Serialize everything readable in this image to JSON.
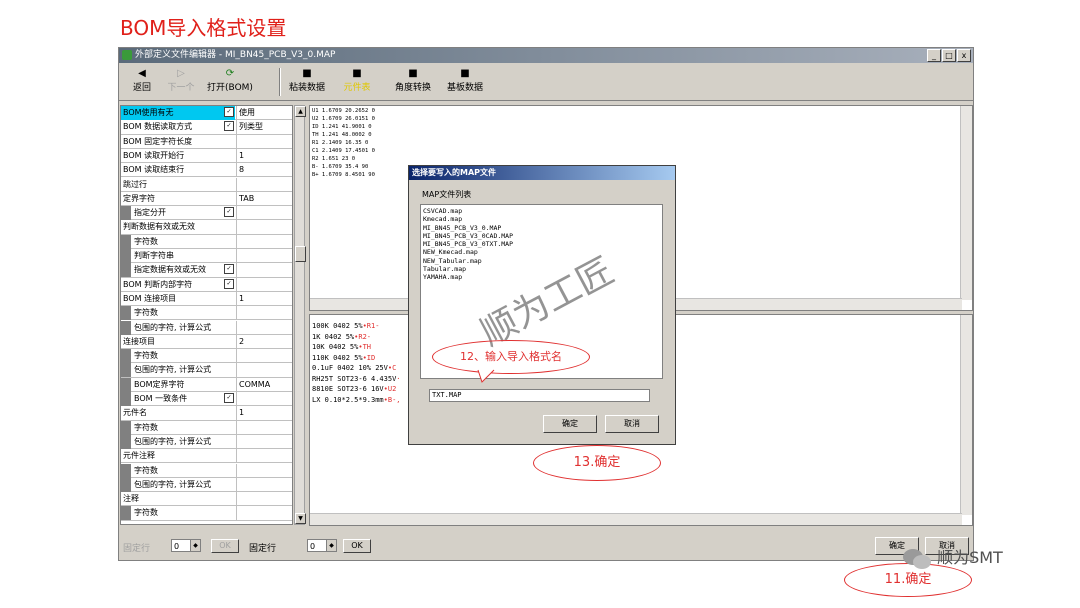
{
  "slide_title": "BOM导入格式设置",
  "window": {
    "title": "外部定义文件编辑器 - MI_BN45_PCB_V3_0.MAP",
    "buttons": {
      "minimize": "_",
      "maximize": "□",
      "close": "x"
    }
  },
  "toolbar": {
    "back": "返回",
    "next": "下一个",
    "open": "打开(BOM)",
    "paste": "粘装数据",
    "angle": "角度转换",
    "board": "基板数据",
    "yellow_item": "元件表"
  },
  "left_rows": [
    {
      "label": "BOM使用有无",
      "value": "使用",
      "indent": false,
      "check": true,
      "selected": true
    },
    {
      "label": "BOM 数据读取方式",
      "value": "列类型",
      "indent": false,
      "check": true
    },
    {
      "label": "BOM 固定字符长度",
      "value": "",
      "indent": false
    },
    {
      "label": "BOM 读取开始行",
      "value": "1",
      "indent": false
    },
    {
      "label": "BOM 读取结束行",
      "value": "8",
      "indent": false
    },
    {
      "label": "跳过行",
      "value": "",
      "indent": false
    },
    {
      "label": "定界字符",
      "value": "TAB",
      "indent": false
    },
    {
      "label": "指定分开",
      "value": "",
      "indent": true,
      "check": true
    },
    {
      "label": "判断数据有效或无效",
      "value": "",
      "indent": false
    },
    {
      "label": "字符数",
      "value": "",
      "indent": true
    },
    {
      "label": "判断字符串",
      "value": "",
      "indent": true
    },
    {
      "label": "指定数据有效或无效",
      "value": "",
      "indent": true,
      "check": true
    },
    {
      "label": "BOM 判断内部字符",
      "value": "",
      "indent": false,
      "check": true
    },
    {
      "label": "BOM 连接项目",
      "value": "1",
      "indent": false
    },
    {
      "label": "字符数",
      "value": "",
      "indent": true
    },
    {
      "label": "包围的字符, 计算公式",
      "value": "",
      "indent": true
    },
    {
      "label": "连接项目",
      "value": "2",
      "indent": false
    },
    {
      "label": "字符数",
      "value": "",
      "indent": true
    },
    {
      "label": "包围的字符, 计算公式",
      "value": "",
      "indent": true
    },
    {
      "label": "BOM定界字符",
      "value": "COMMA",
      "indent": true
    },
    {
      "label": "BOM 一致条件",
      "value": "",
      "indent": true,
      "check": true
    },
    {
      "label": "元件名",
      "value": "1",
      "indent": false
    },
    {
      "label": "字符数",
      "value": "",
      "indent": true
    },
    {
      "label": "包围的字符, 计算公式",
      "value": "",
      "indent": true
    },
    {
      "label": "元件注释",
      "value": "",
      "indent": false
    },
    {
      "label": "字符数",
      "value": "",
      "indent": true
    },
    {
      "label": "包围的字符, 计算公式",
      "value": "",
      "indent": true
    },
    {
      "label": "注释",
      "value": "",
      "indent": false
    },
    {
      "label": "字符数",
      "value": "",
      "indent": true
    }
  ],
  "top_pane_lines": [
    "U1 1.6709 20.2652 0",
    "U2 1.6709 26.0151 0",
    "ID 1.241 41.9001 0",
    "TH 1.241 48.0002 0",
    "R1 2.1409 16.35 0",
    "C1 2.1409 17.4501 0",
    "R2 1.651 23 0",
    "B- 1.6709 35.4 90",
    "B+ 1.6709 8.4501 90"
  ],
  "bottom_pane_lines": [
    {
      "a": "100K 0402 5%",
      "b": "•R1-"
    },
    {
      "a": "1K 0402 5%",
      "b": "•R2-"
    },
    {
      "a": "10K 0402 5%",
      "b": "•TH"
    },
    {
      "a": "110K 0402 5%",
      "b": "•ID"
    },
    {
      "a": "0.1uF 0402 10% 25V",
      "b": "•C"
    },
    {
      "a": "RH25T SOT23-6 4.435V",
      "b": "·"
    },
    {
      "a": "8810E SOT23-6 16V",
      "b": "•U2"
    },
    {
      "a": "LX 0.10*2.5*9.3mm",
      "b": "•B-,"
    }
  ],
  "bottom_bar": {
    "fixed_row_left": "固定行",
    "spin_left": "0",
    "ok_left": "OK",
    "fixed_row_right": "固定行",
    "spin_right": "0",
    "ok_right": "OK",
    "confirm": "确定",
    "cancel": "取消"
  },
  "dialog": {
    "title": "选择要写入的MAP文件",
    "list_label": "MAP文件列表",
    "files": [
      "CSVCAD.map",
      "Kmecad.map",
      "MI_BN45_PCB_V3_0.MAP",
      "MI_BN45_PCB_V3_0CAD.MAP",
      "MI_BN45_PCB_V3_0TXT.MAP",
      "NEW_Kmecad.map",
      "NEW_Tabular.map",
      "Tabular.map",
      "YAMAHA.map"
    ],
    "input_value": "TXT.MAP",
    "ok": "确定",
    "cancel": "取消"
  },
  "annotations": {
    "step12": "12、输入导入格式名",
    "step13": "13.确定",
    "step11": "11.确定",
    "watermark": "顺为工匠",
    "brand": "顺为SMT"
  },
  "colors": {
    "title_red": "#e0201a",
    "selected_row": "#00c8f0",
    "annotation_red": "#e03030"
  }
}
